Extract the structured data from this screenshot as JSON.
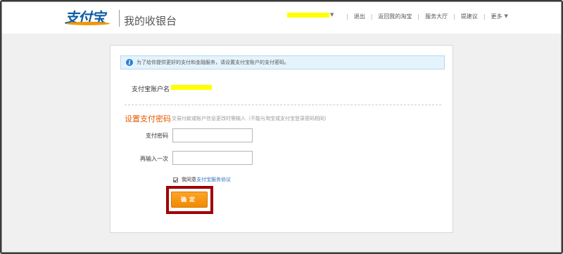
{
  "header": {
    "logo_text": "支付宝",
    "app_title": "我的收银台",
    "nav": [
      "退出",
      "返回我的淘宝",
      "服务大厅",
      "提建议"
    ],
    "more_label": "更多"
  },
  "notice": {
    "icon": "info-icon",
    "text": "为了给你提供更好的支付和金融服务，请设置支付宝账户的支付密码。"
  },
  "account": {
    "label": "支付宝账户名"
  },
  "form": {
    "section_title": "设置支付密码",
    "section_hint": "交易付款或账户信息更改时需输入（不能与淘宝或支付宝登录密码相同）",
    "password_label": "支付密码",
    "password_value": "",
    "confirm_label": "再输入一次",
    "confirm_value": "",
    "agree_prefix": "我同意",
    "agree_link": "支付宝服务协议",
    "agree_checked": true,
    "submit_label": "确定"
  },
  "colors": {
    "brand_blue": "#0d5ca6",
    "brand_orange": "#f29600",
    "section_title": "#e55a00",
    "button": "#f39200",
    "annotation_box": "#a00000"
  }
}
